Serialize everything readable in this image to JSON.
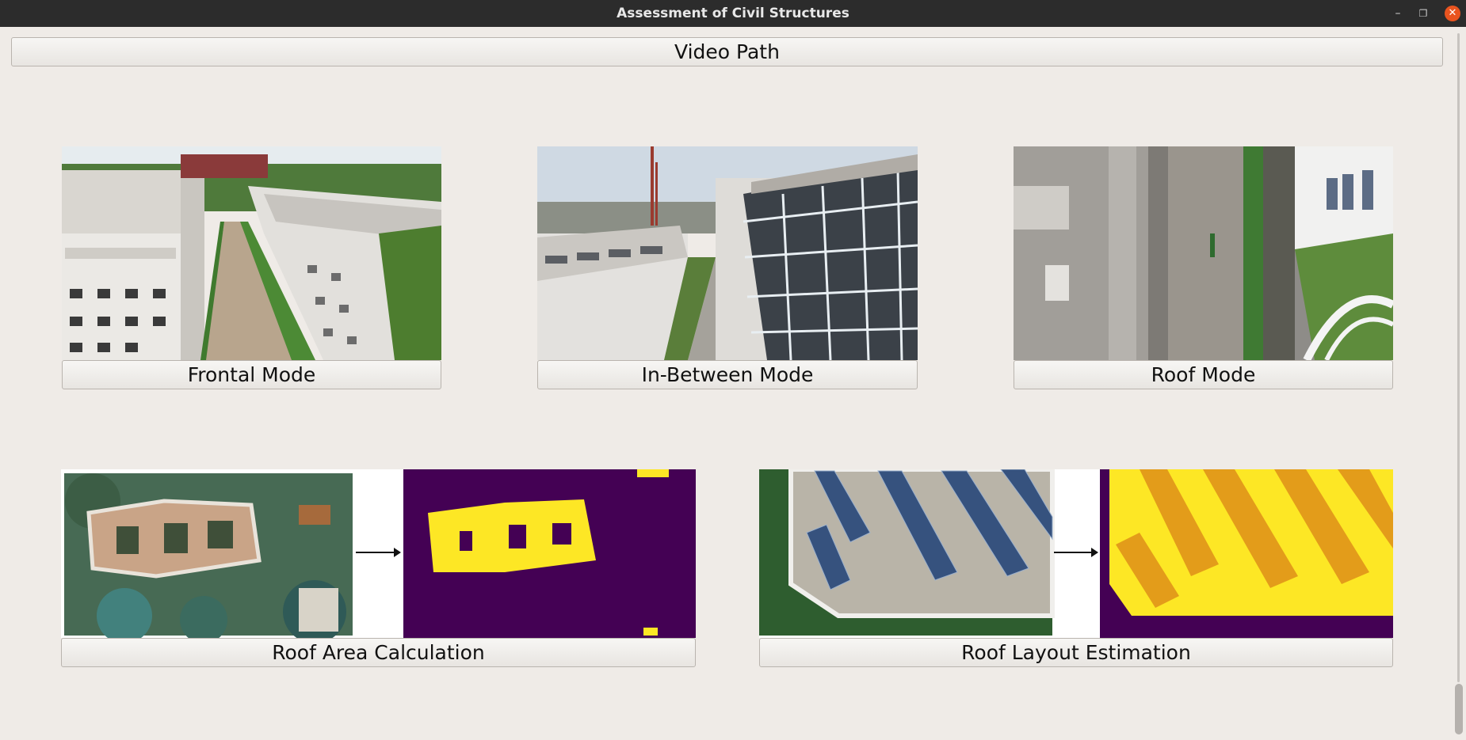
{
  "window": {
    "title": "Assessment of Civil Structures",
    "controls": {
      "minimize_icon": "–",
      "maximize_icon": "❐",
      "close_icon": "✕"
    }
  },
  "toolbar": {
    "video_path_label": "Video Path"
  },
  "modes": {
    "frontal_label": "Frontal Mode",
    "in_between_label": "In-Between Mode",
    "roof_label": "Roof Mode"
  },
  "analysis": {
    "roof_area_label": "Roof Area Calculation",
    "roof_layout_label": "Roof Layout Estimation"
  },
  "colors": {
    "titlebar": "#2c2c2c",
    "background": "#efebe7",
    "close_button": "#e9541f",
    "segmentation_background": "#440154",
    "segmentation_roof": "#fde725",
    "segmentation_panels": "#e39c1a"
  }
}
